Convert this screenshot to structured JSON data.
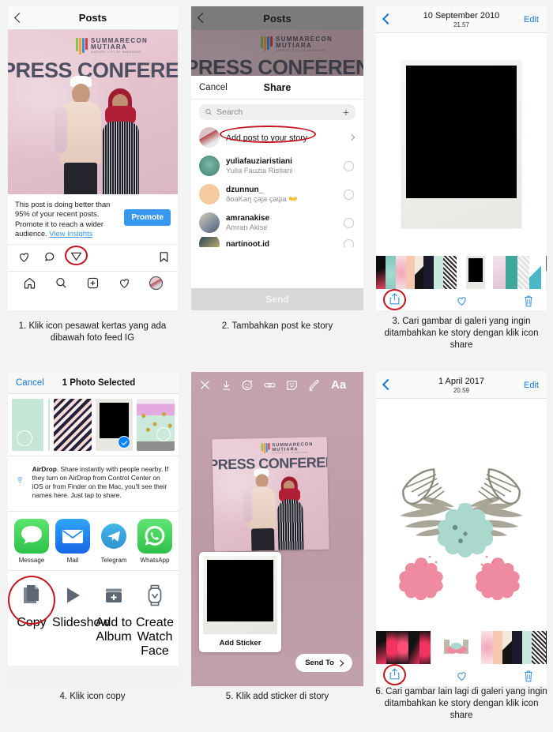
{
  "tutorial": {
    "captions": [
      "1. Klik icon pesawat kertas yang ada dibawah foto feed IG",
      "2. Tambahkan post ke story",
      "3. Cari gambar di galeri yang ingin ditambahkan ke story dengan klik icon share",
      "4. Klik icon copy",
      "5. Klik add sticker di story",
      "6. Cari gambar lain lagi di galeri yang ingin ditambahkan ke story dengan klik icon share"
    ]
  },
  "panel1": {
    "nav": {
      "title": "Posts",
      "back_icon": "chevron-left-icon"
    },
    "photo": {
      "brand_line1": "SUMMARECON",
      "brand_line2": "MUTIARA",
      "brand_line3": "AIRPORT CITY OF MAKASSAR",
      "headline": "PRESS CONFERENC"
    },
    "promote": {
      "text": "This post is doing better than 95% of your recent posts. Promote it to reach a wider audience. ",
      "link": "View Insights",
      "button": "Promote",
      "button_color": "#3897f0"
    },
    "actions": [
      "heart-icon",
      "comment-icon",
      "paper-plane-icon",
      "bookmark-icon"
    ],
    "tabbar": [
      "home-icon",
      "search-icon",
      "add-post-icon",
      "activity-icon",
      "profile-avatar-icon"
    ],
    "highlight_color": "#c4121f"
  },
  "panel2": {
    "nav": {
      "title": "Posts",
      "back_icon": "chevron-left-icon"
    },
    "photo": {
      "brand_line1": "SUMMARECON",
      "brand_line2": "MUTIARA",
      "brand_line3": "AIRPORT CITY OF MAKASSAR",
      "headline": "PRESS CONFERENC"
    },
    "share": {
      "cancel": "Cancel",
      "title": "Share",
      "search_placeholder": "Search",
      "send_label": "Send",
      "rows": [
        {
          "name": "Add post to your story",
          "sub": "",
          "type": "story",
          "highlighted": true
        },
        {
          "name": "yuliafauziaristiani",
          "sub": "Yulia Fauzia Ristiani",
          "type": "user"
        },
        {
          "name": "dzunnun_",
          "sub": "ðoaKaŋ çaja çaψa  👐",
          "type": "user"
        },
        {
          "name": "amranakise",
          "sub": "Amran Akise",
          "type": "user"
        },
        {
          "name": "nartinoot.id",
          "sub": "",
          "type": "user"
        }
      ]
    }
  },
  "panel3": {
    "nav": {
      "date": "10 September 2010",
      "time": "21.57",
      "edit": "Edit",
      "back_icon": "chevron-left-icon"
    },
    "tools": [
      "share-icon",
      "heart-icon",
      "trash-icon"
    ],
    "highlighted_tool": "share-icon",
    "accent_color": "#3a93d6"
  },
  "panel4": {
    "nav": {
      "cancel": "Cancel",
      "title": "1 Photo Selected"
    },
    "airdrop": {
      "label": "AirDrop",
      "text": ". Share instantly with people nearby. If they turn on AirDrop from Control Center on iOS or from Finder on the Mac, you'll see their names here. Just tap to share."
    },
    "apps": [
      {
        "label": "Message",
        "icon": "message-icon",
        "color": "#4cd257"
      },
      {
        "label": "Mail",
        "icon": "mail-icon",
        "color": "#1d8ef6"
      },
      {
        "label": "Telegram",
        "icon": "telegram-icon",
        "color": "#35aadc"
      },
      {
        "label": "WhatsApp",
        "icon": "whatsapp-icon",
        "color": "#4ad860"
      }
    ],
    "actions": [
      {
        "label": "Copy",
        "icon": "copy-icon",
        "highlighted": true
      },
      {
        "label": "Slideshow",
        "icon": "play-icon"
      },
      {
        "label": "Add to Album",
        "icon": "add-to-album-icon"
      },
      {
        "label": "Create Watch Face",
        "icon": "watch-face-icon"
      }
    ]
  },
  "panel5": {
    "tools": [
      "close-icon",
      "download-icon",
      "effects-icon",
      "link-icon",
      "sticker-icon",
      "draw-icon",
      "text-icon"
    ],
    "text_tool_label": "Aa",
    "sticker_card_label": "Add Sticker",
    "send_to_label": "Send To",
    "photo": {
      "brand_line1": "SUMMARECON",
      "brand_line2": "MUTIARA",
      "brand_line3": "AIRPORT CITY OF MAKASSAR",
      "headline": "PRESS CONFERENC"
    }
  },
  "panel6": {
    "nav": {
      "date": "1 April 2017",
      "time": "20.59",
      "edit": "Edit",
      "back_icon": "chevron-left-icon"
    },
    "tools": [
      "share-icon",
      "heart-icon",
      "trash-icon"
    ],
    "highlighted_tool": "share-icon",
    "accent_color": "#3a93d6",
    "artwork": "floral-wreath-mint-pink"
  }
}
